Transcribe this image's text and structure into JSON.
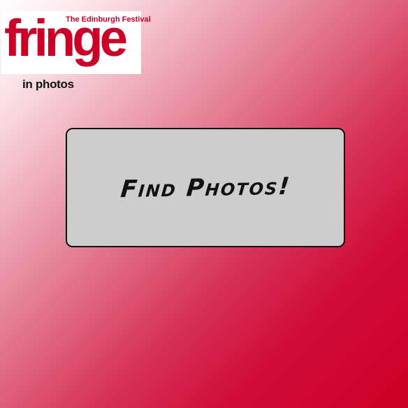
{
  "logo": {
    "festival": "The Edinburgh Festival",
    "word": "fringe",
    "tagline": "in photos"
  },
  "main": {
    "find_button_label": "Find Photos!"
  },
  "colors": {
    "brand_red": "#cc0026",
    "button_bg": "#cdcdcd",
    "text_dark": "#111111"
  }
}
